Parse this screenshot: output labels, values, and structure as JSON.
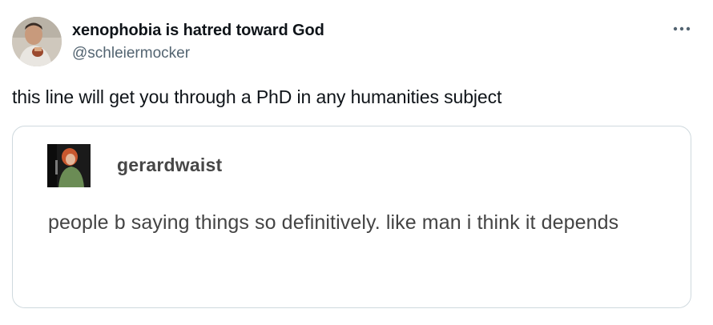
{
  "tweet": {
    "display_name": "xenophobia is hatred toward God",
    "handle": "@schleiermocker",
    "text": "this line will get you through a PhD in any humanities subject",
    "more_icon": "more-horizontal-icon"
  },
  "quoted_post": {
    "username": "gerardwaist",
    "text": "people b saying things so definitively. like man i think it depends"
  },
  "colors": {
    "text_primary": "#0f1419",
    "text_secondary": "#536471",
    "border": "#cfd9de",
    "quote_text": "#444444"
  }
}
